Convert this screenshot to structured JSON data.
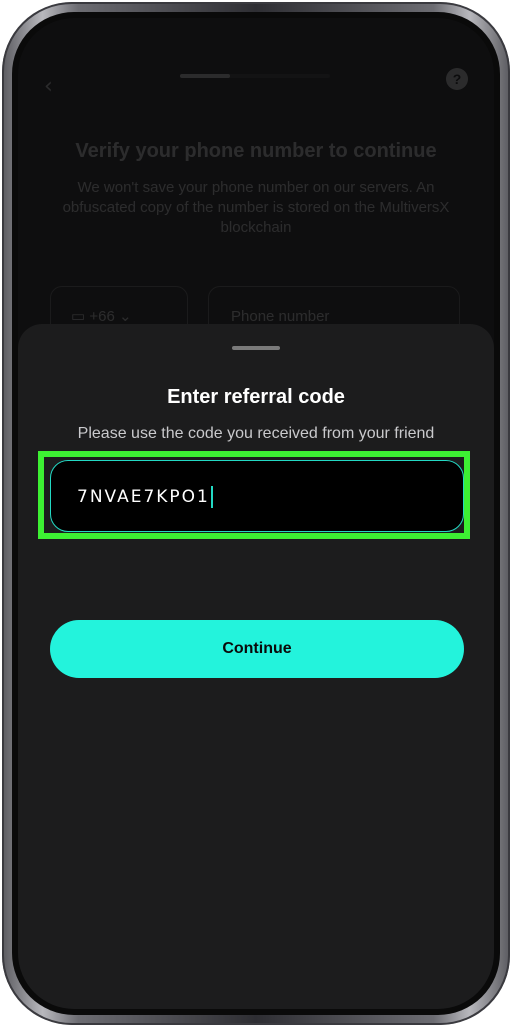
{
  "background_page": {
    "back_icon": "chevron-left-icon",
    "progress_fraction": 0.33,
    "help_icon": "chat-help-icon",
    "title": "Verify your phone number to continue",
    "subtitle": "We won't save your phone number on our servers. An obfuscated copy of the number is stored on the MultiversX blockchain",
    "country_code": "+66",
    "phone_placeholder": "Phone number"
  },
  "sheet": {
    "title": "Enter referral code",
    "subtitle": "Please use the code you received from your friend",
    "code_value": "7NVAE7KPO1",
    "continue_label": "Continue"
  },
  "colors": {
    "accent": "#23f3dc",
    "highlight": "#3df033",
    "sheet_bg": "#1c1c1d"
  }
}
